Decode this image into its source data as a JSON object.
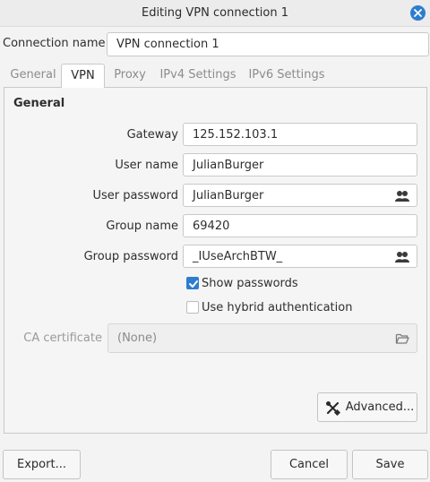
{
  "window": {
    "title": "Editing VPN connection 1"
  },
  "connection": {
    "label": "Connection name",
    "value": "VPN connection 1"
  },
  "tabs": [
    {
      "label": "General",
      "active": false
    },
    {
      "label": "VPN",
      "active": true
    },
    {
      "label": "Proxy",
      "active": false
    },
    {
      "label": "IPv4 Settings",
      "active": false
    },
    {
      "label": "IPv6 Settings",
      "active": false
    }
  ],
  "vpn": {
    "section_title": "General",
    "gateway": {
      "label": "Gateway",
      "value": "125.152.103.1"
    },
    "user_name": {
      "label": "User name",
      "value": "JulianBurger"
    },
    "user_password": {
      "label": "User password",
      "value": "JulianBurger"
    },
    "group_name": {
      "label": "Group name",
      "value": "69420"
    },
    "group_password": {
      "label": "Group password",
      "value": "_IUseArchBTW_"
    },
    "show_passwords": {
      "label": "Show passwords",
      "checked": true
    },
    "hybrid_auth": {
      "label": "Use hybrid authentication",
      "checked": false
    },
    "ca_certificate": {
      "label": "CA certificate",
      "value": "(None)"
    },
    "advanced_button": "Advanced..."
  },
  "footer": {
    "export": "Export...",
    "cancel": "Cancel",
    "save": "Save"
  },
  "colors": {
    "accent": "#2d7dcf"
  }
}
